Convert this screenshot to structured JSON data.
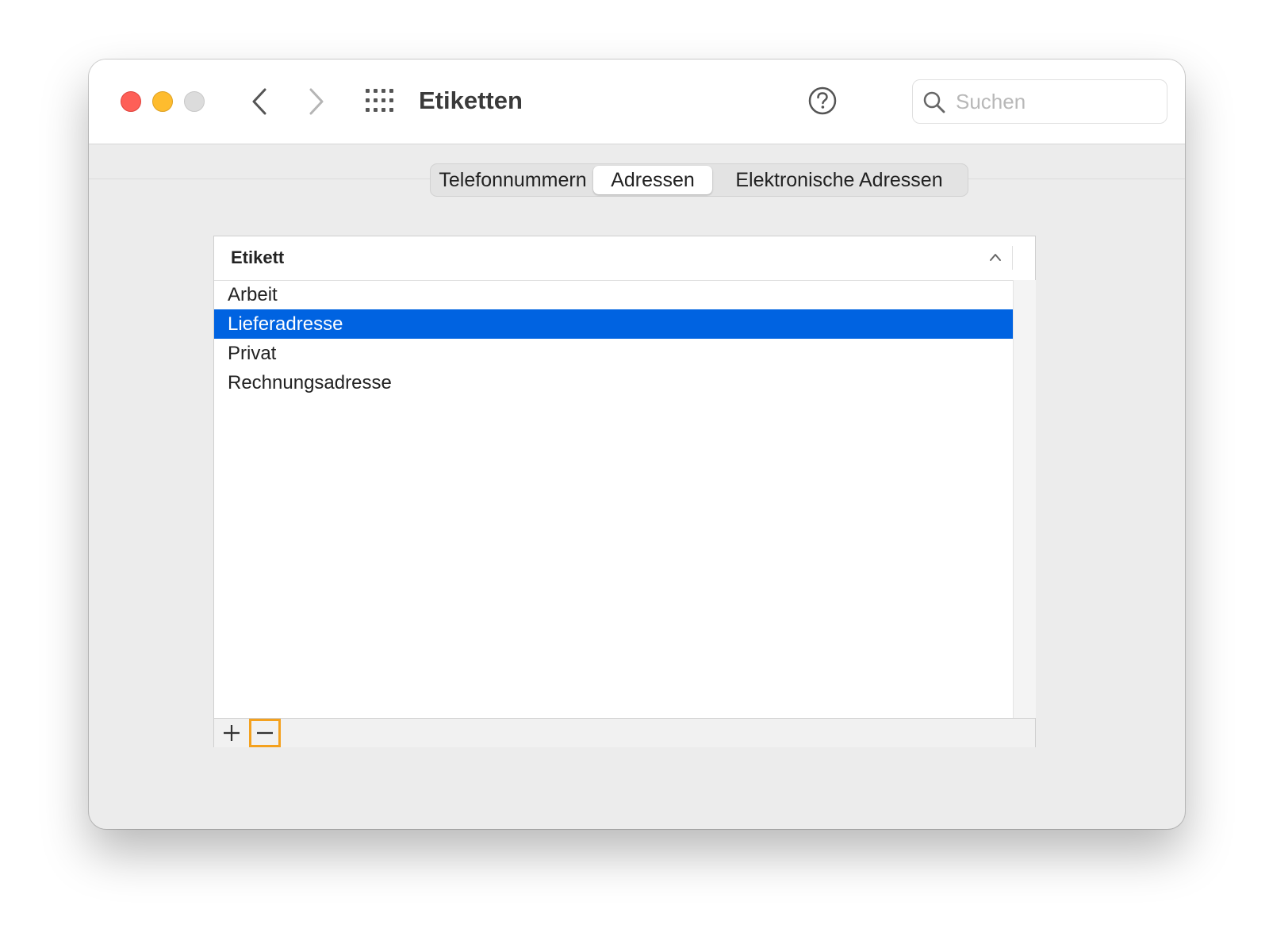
{
  "window": {
    "title": "Etiketten",
    "search_placeholder": "Suchen"
  },
  "icons": {
    "back": "chevron-left-icon",
    "forward": "chevron-right-icon",
    "grid": "grid-icon",
    "help": "question-mark-icon",
    "search": "search-icon",
    "sort": "chevron-up-icon",
    "add": "plus-icon",
    "remove": "minus-icon"
  },
  "tabs": [
    {
      "label": "Telefonnummern",
      "active": false
    },
    {
      "label": "Adressen",
      "active": true
    },
    {
      "label": "Elektronische Adressen",
      "active": false
    }
  ],
  "table": {
    "column_header": "Etikett",
    "rows": [
      {
        "label": "Arbeit",
        "selected": false
      },
      {
        "label": "Lieferadresse",
        "selected": true
      },
      {
        "label": "Privat",
        "selected": false
      },
      {
        "label": "Rechnungsadresse",
        "selected": false
      }
    ]
  },
  "colors": {
    "selection": "#0063e1",
    "highlight_outline": "#f4a11e",
    "close": "#fe5f57",
    "minimize": "#febc2e"
  }
}
